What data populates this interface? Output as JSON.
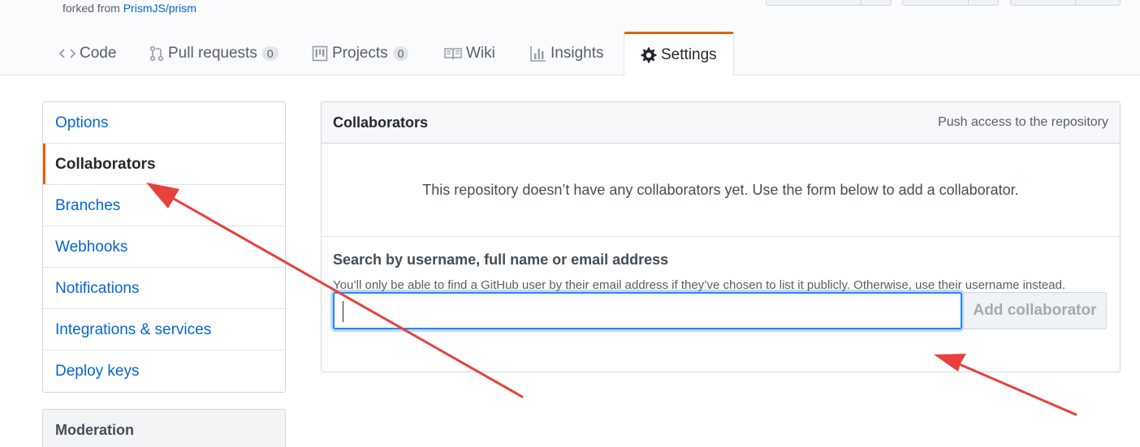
{
  "repo": {
    "forked_prefix": "forked from ",
    "forked_link": "PrismJS/prism"
  },
  "tabs": [
    {
      "label": "Code",
      "icon": "code-icon"
    },
    {
      "label": "Pull requests",
      "icon": "pull-request-icon",
      "count": "0"
    },
    {
      "label": "Projects",
      "icon": "project-icon",
      "count": "0"
    },
    {
      "label": "Wiki",
      "icon": "book-icon"
    },
    {
      "label": "Insights",
      "icon": "graph-icon"
    },
    {
      "label": "Settings",
      "icon": "gear-icon",
      "selected": true
    }
  ],
  "sidebar": {
    "items": [
      {
        "label": "Options"
      },
      {
        "label": "Collaborators",
        "selected": true
      },
      {
        "label": "Branches"
      },
      {
        "label": "Webhooks"
      },
      {
        "label": "Notifications"
      },
      {
        "label": "Integrations & services"
      },
      {
        "label": "Deploy keys"
      }
    ],
    "moderation_heading": "Moderation"
  },
  "collaborators": {
    "title": "Collaborators",
    "note": "Push access to the repository",
    "empty_message": "This repository doesn’t have any collaborators yet. Use the form below to add a collaborator.",
    "search_label": "Search by username, full name or email address",
    "search_note": "You’ll only be able to find a GitHub user by their email address if they’ve chosen to list it publicly. Otherwise, use their username instead.",
    "search_value": "",
    "add_button": "Add collaborator"
  },
  "colors": {
    "accent": "#e36209",
    "link": "#0366d6",
    "annotation_arrow": "#e8413c"
  }
}
